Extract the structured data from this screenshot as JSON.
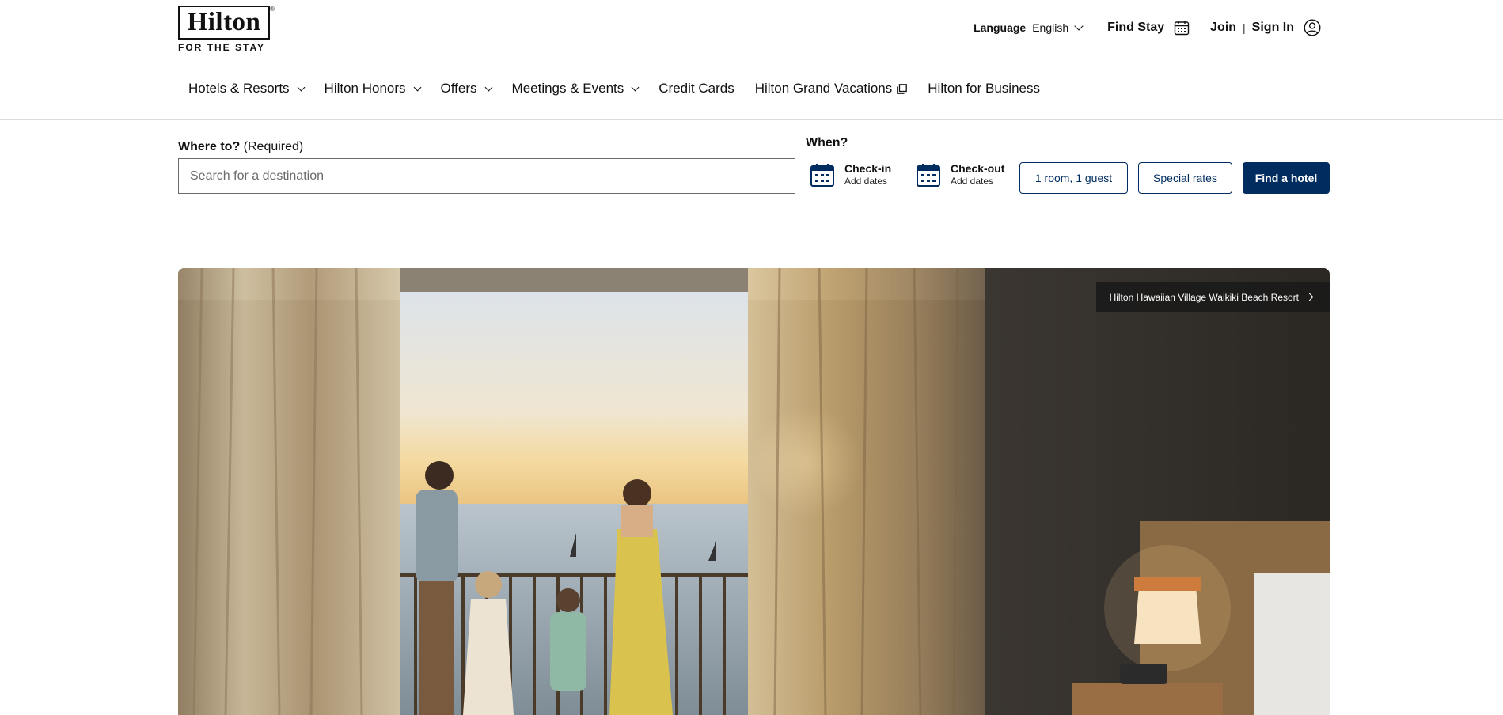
{
  "brand": {
    "logo_text": "Hilton",
    "tagline": "FOR THE STAY",
    "trademark": "®"
  },
  "utility_nav": {
    "language_label": "Language",
    "language_value": "English",
    "find_stay": "Find Stay",
    "join": "Join",
    "separator": "|",
    "sign_in": "Sign In"
  },
  "main_nav": {
    "items": [
      {
        "label": "Hotels & Resorts",
        "icon": "chevron-down-icon"
      },
      {
        "label": "Hilton Honors",
        "icon": "chevron-down-icon"
      },
      {
        "label": "Offers",
        "icon": "chevron-down-icon"
      },
      {
        "label": "Meetings & Events",
        "icon": "chevron-down-icon"
      },
      {
        "label": "Credit Cards"
      },
      {
        "label": "Hilton Grand Vacations",
        "icon": "external-link-icon"
      },
      {
        "label": "Hilton for Business"
      }
    ]
  },
  "search": {
    "where_label": "Where to?",
    "where_required": "(Required)",
    "destination_placeholder": "Search for a destination",
    "destination_value": "",
    "when_label": "When?",
    "check_in_title": "Check-in",
    "check_in_sub": "Add dates",
    "check_out_title": "Check-out",
    "check_out_sub": "Add dates",
    "rooms_guests": "1 room, 1 guest",
    "special_rates": "Special rates",
    "find_hotel": "Find a hotel"
  },
  "hero": {
    "caption": "Hilton Hawaiian Village Waikiki Beach Resort"
  },
  "colors": {
    "brand_navy": "#002c5f",
    "text": "#111111",
    "divider": "#dcdcdc"
  }
}
